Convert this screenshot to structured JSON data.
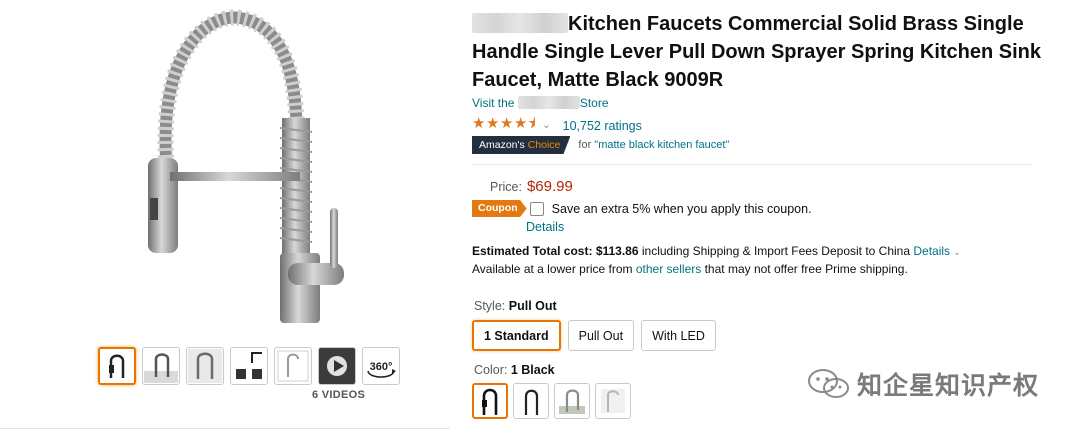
{
  "product": {
    "title_suffix": "Kitchen Faucets Commercial Solid Brass Single Handle Single Lever Pull Down Sprayer Spring Kitchen Sink Faucet, Matte Black 9009R",
    "store_prefix": "Visit the",
    "store_suffix": "Store",
    "stars_display": "★★★★⯨",
    "rating_chevron": "⌄",
    "ratings_count": "10,752 ratings",
    "choice_badge_1": "Amazon's",
    "choice_badge_2": "Choice",
    "choice_for": "for",
    "choice_term": "\"matte black kitchen faucet\"",
    "rating_value": 4.5
  },
  "price": {
    "label": "Price:",
    "value": "$69.99"
  },
  "coupon": {
    "badge": "Coupon",
    "text": "Save an extra 5% when you apply this coupon.",
    "details": "Details"
  },
  "total": {
    "label": "Estimated Total cost:",
    "amount": "$113.86",
    "text": "including Shipping & Import Fees Deposit to China",
    "details": "Details",
    "lower_1": "Available at a lower price from",
    "lower_link": "other sellers",
    "lower_2": "that may not offer free Prime shipping."
  },
  "style": {
    "label": "Style:",
    "selected": "Pull Out",
    "options": [
      "1 Standard",
      "Pull Out",
      "With LED"
    ]
  },
  "color": {
    "label": "Color:",
    "selected": "1 Black"
  },
  "gallery": {
    "videos_label": "6 VIDEOS",
    "label_360": "360°"
  },
  "watermark": {
    "text": "知企星知识产权"
  },
  "colors": {
    "link": "#007185",
    "price": "#b12704",
    "accent": "#e77600",
    "coupon": "#e47911",
    "badge_dark": "#232f3e"
  }
}
